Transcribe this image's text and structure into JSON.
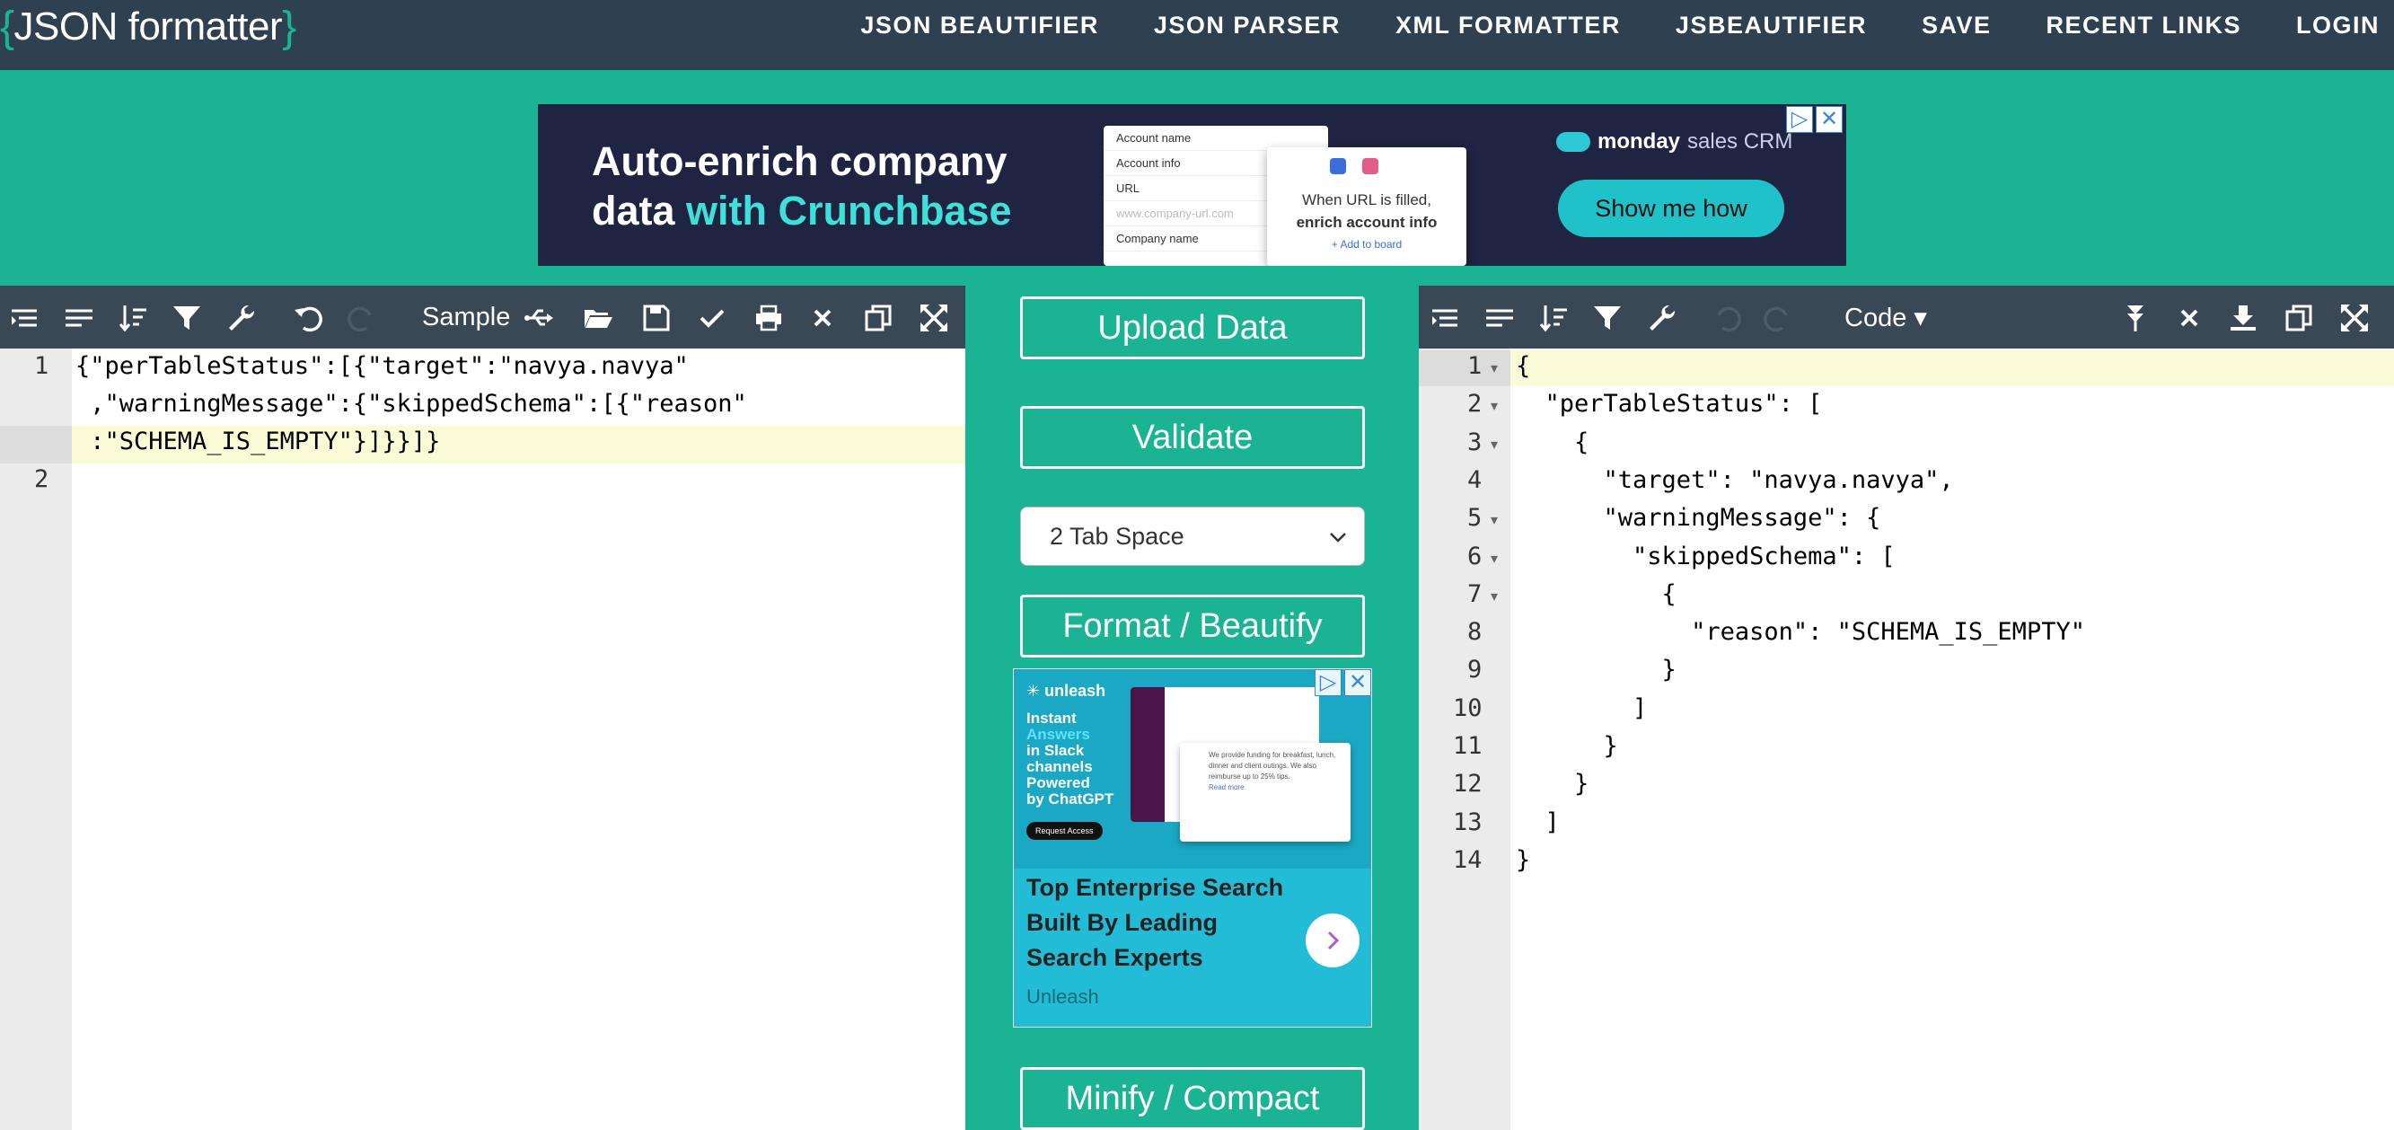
{
  "header": {
    "logo": {
      "brace_open": "{",
      "text": "JSON formatter",
      "brace_close": "}"
    },
    "nav": [
      "JSON BEAUTIFIER",
      "JSON PARSER",
      "XML FORMATTER",
      "JSBEAUTIFIER",
      "SAVE",
      "RECENT LINKS",
      "LOGIN"
    ]
  },
  "ad_top": {
    "headline_line1": "Auto-enrich company",
    "headline_line2_plain": "data ",
    "headline_line2_highlight": "with Crunchbase",
    "mock_account_name": "Account name",
    "mock_account_info": "Account info",
    "mock_url_label": "URL",
    "mock_url_placeholder": "www.company-url.com",
    "mock_company_name": "Company name",
    "mock_tip_line1": "When URL is filled,",
    "mock_tip_line2": "enrich account info",
    "mock_add": "+ Add to board",
    "brand_bold": "monday",
    "brand_rest": " sales CRM",
    "cta": "Show me how",
    "badge_info": "▷",
    "badge_close": "✕"
  },
  "left_editor": {
    "toolbar": {
      "sample_label": "Sample"
    },
    "line_numbers": [
      "1",
      "",
      "",
      "2"
    ],
    "lines": [
      "{\"perTableStatus\":[{\"target\":\"navya.navya\"",
      " ,\"warningMessage\":{\"skippedSchema\":[{\"reason\"",
      " :\"SCHEMA_IS_EMPTY\"}]}}]}"
    ]
  },
  "middle": {
    "upload_label": "Upload Data",
    "validate_label": "Validate",
    "indent_select": {
      "selected": "2 Tab Space"
    },
    "format_label": "Format / Beautify",
    "minify_label": "Minify / Compact"
  },
  "ad_side": {
    "brand": "unleash",
    "tagline": [
      "Instant",
      "Answers",
      "in Slack",
      "channels",
      "Powered",
      "by ChatGPT"
    ],
    "request_access": "Request Access",
    "mock_msg": "We provide funding for breakfast, lunch, dinner and client outings. We also reimburse up to 25% tips.",
    "mock_read_more": "Read more",
    "title": "Top Enterprise Search Built By Leading Search Experts",
    "advertiser": "Unleash",
    "badge_info": "▷",
    "badge_close": "✕"
  },
  "right_editor": {
    "toolbar": {
      "mode_label": "Code ▾"
    },
    "line_numbers": [
      "1",
      "2",
      "3",
      "4",
      "5",
      "6",
      "7",
      "8",
      "9",
      "10",
      "11",
      "12",
      "13",
      "14"
    ],
    "lines": [
      "{",
      "  \"perTableStatus\": [",
      "    {",
      "      \"target\": \"navya.navya\",",
      "      \"warningMessage\": {",
      "        \"skippedSchema\": [",
      "          {",
      "            \"reason\": \"SCHEMA_IS_EMPTY\"",
      "          }",
      "        ]",
      "      }",
      "    }",
      "  ]",
      "}"
    ]
  },
  "colors": {
    "teal": "#1ab394",
    "header_bg": "#2f4050",
    "toolbar_bg": "#3a4755",
    "string": "#008000",
    "active_line": "#fbfbd7"
  }
}
